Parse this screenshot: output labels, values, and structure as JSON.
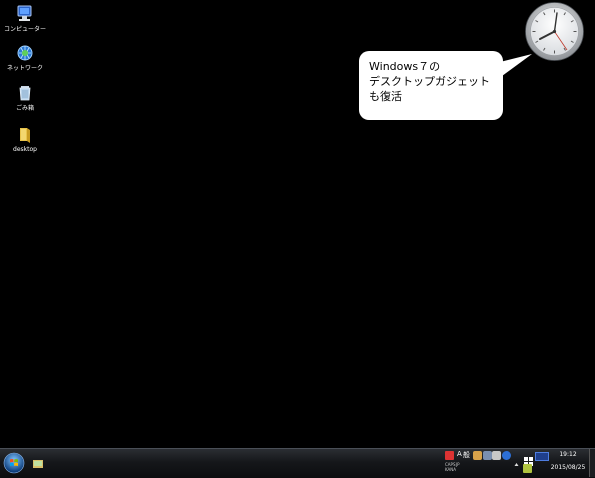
{
  "desktop_icons": [
    {
      "label": "コンピューター",
      "icon": "computer-icon"
    },
    {
      "label": "ネットワーク",
      "icon": "network-icon"
    },
    {
      "label": "ごみ箱",
      "icon": "recycle-bin-icon"
    },
    {
      "label": "desktop",
      "icon": "folder-icon"
    }
  ],
  "callout": {
    "line1": "Windows７の",
    "line2": "デスクトップガジェット",
    "line3": "も復活"
  },
  "gadget": {
    "type": "analog-clock"
  },
  "taskbar": {
    "start": "start-orb-icon",
    "pinned": [
      "explorer-folder-icon"
    ],
    "tray": {
      "ime_mode": "A",
      "ime_kanji": "般",
      "caps_label": "CAPS",
      "kana_label": "KANA",
      "jp_label": "JP",
      "time": "19:12",
      "date": "2015/08/25"
    }
  },
  "colors": {
    "desktop_bg": "#000000",
    "taskbar_bg": "#1a1c1f",
    "callout_bg": "#ffffff"
  }
}
